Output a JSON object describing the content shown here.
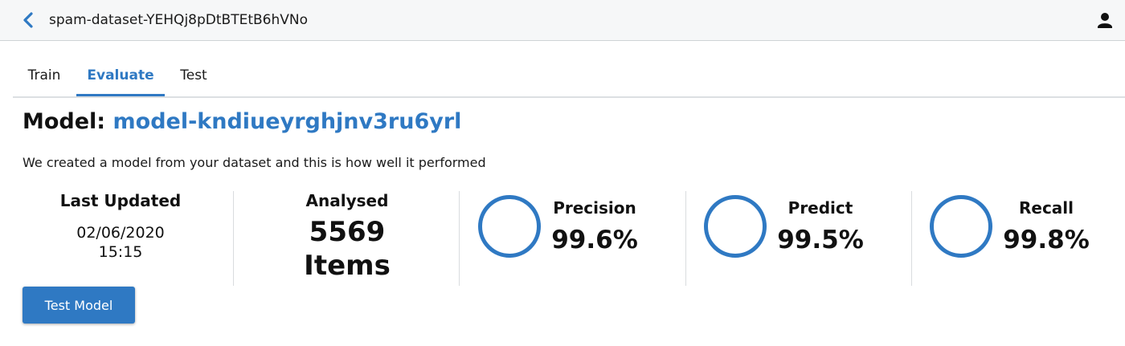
{
  "header": {
    "title": "spam-dataset-YEHQj8pDtBTEtB6hVNo"
  },
  "tabs": [
    {
      "label": "Train",
      "active": false
    },
    {
      "label": "Evaluate",
      "active": true
    },
    {
      "label": "Test",
      "active": false
    }
  ],
  "model": {
    "label": "Model:",
    "name": "model-kndiueyrghjnv3ru6yrl",
    "description": "We created a model from your dataset and this is how well it performed"
  },
  "stats": {
    "last_updated_label": "Last Updated",
    "last_updated_date": "02/06/2020",
    "last_updated_time": "15:15",
    "analysed_label": "Analysed",
    "analysed_count": "5569",
    "analysed_unit": "Items"
  },
  "metrics": [
    {
      "label": "Precision",
      "value": "99.6%"
    },
    {
      "label": "Predict",
      "value": "99.5%"
    },
    {
      "label": "Recall",
      "value": "99.8%"
    }
  ],
  "actions": {
    "test_model_label": "Test Model"
  },
  "colors": {
    "accent": "#2f79c3",
    "topbar": "#f6f7f8"
  },
  "icons": {
    "back": "chevron-left-icon",
    "user": "user-icon"
  }
}
